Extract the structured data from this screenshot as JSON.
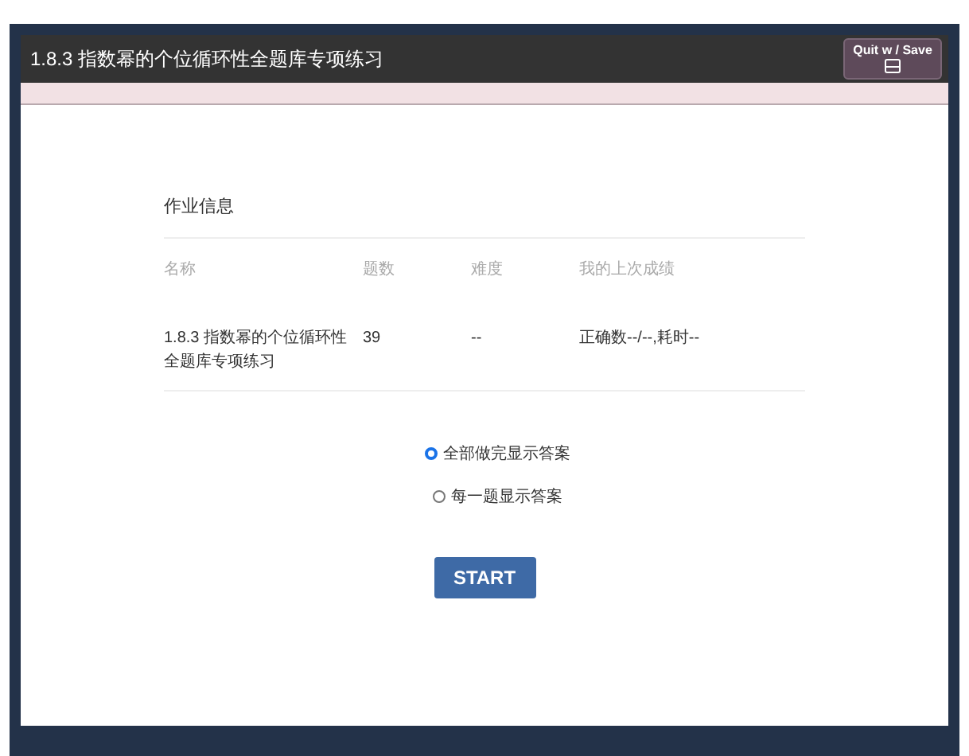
{
  "window": {
    "title": "1.8.3 指数幂的个位循环性全题库专项练习",
    "quit_button": "Quit w / Save"
  },
  "section_title": "作业信息",
  "table": {
    "columns": [
      "名称",
      "题数",
      "难度",
      "我的上次成绩"
    ],
    "rows": [
      [
        "1.8.3 指数幂的个位循环性全题库专项练习",
        "39",
        "--",
        "正确数--/--,耗时--"
      ]
    ]
  },
  "options": [
    {
      "label": "全部做完显示答案",
      "selected": true
    },
    {
      "label": "每一题显示答案",
      "selected": false
    }
  ],
  "start_button": "START"
}
